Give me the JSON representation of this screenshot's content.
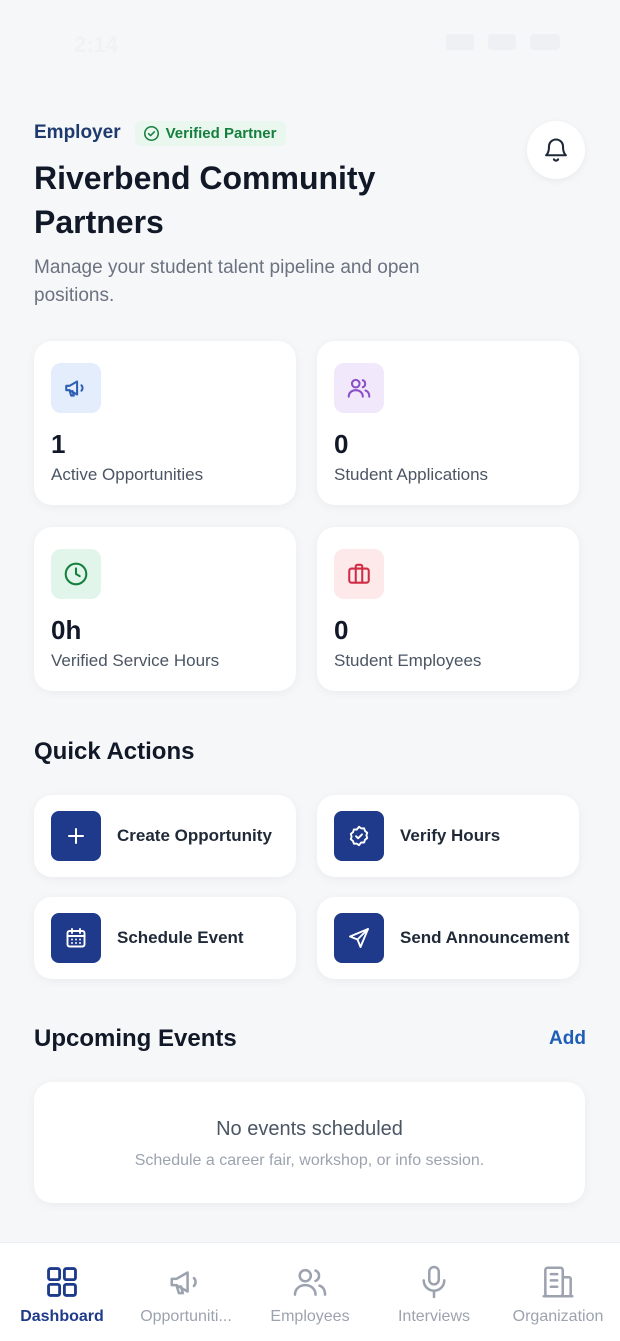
{
  "status": {
    "time": "2:14"
  },
  "header": {
    "role": "Employer",
    "badge": "Verified Partner",
    "org_name": "Riverbend Community Partners",
    "subtitle": "Manage your student talent pipeline and open positions."
  },
  "stats": [
    {
      "value": "1",
      "label": "Active Opportunities",
      "icon": "megaphone-icon",
      "bg": "#e3edfb",
      "fg": "#2f5fb3"
    },
    {
      "value": "0",
      "label": "Student Applications",
      "icon": "users-icon",
      "bg": "#f1e9fb",
      "fg": "#8b4fc9"
    },
    {
      "value": "0h",
      "label": "Verified Service Hours",
      "icon": "clock-icon",
      "bg": "#e2f5ea",
      "fg": "#15803d"
    },
    {
      "value": "0",
      "label": "Student Employees",
      "icon": "briefcase-icon",
      "bg": "#fde8ea",
      "fg": "#d12c45"
    }
  ],
  "quick_actions": {
    "title": "Quick Actions",
    "items": [
      {
        "label": "Create Opportunity",
        "icon": "plus-icon"
      },
      {
        "label": "Verify Hours",
        "icon": "badge-check-icon"
      },
      {
        "label": "Schedule Event",
        "icon": "calendar-icon"
      },
      {
        "label": "Send Announcement",
        "icon": "send-icon"
      }
    ]
  },
  "events": {
    "title": "Upcoming Events",
    "add_label": "Add",
    "empty_title": "No events scheduled",
    "empty_hint": "Schedule a career fair, workshop, or info session."
  },
  "tabs": [
    {
      "label": "Dashboard",
      "icon": "grid-icon",
      "active": true
    },
    {
      "label": "Opportuniti...",
      "icon": "megaphone-icon",
      "active": false
    },
    {
      "label": "Employees",
      "icon": "users-icon",
      "active": false
    },
    {
      "label": "Interviews",
      "icon": "microphone-icon",
      "active": false
    },
    {
      "label": "Organization",
      "icon": "building-icon",
      "active": false
    }
  ],
  "colors": {
    "accent": "#1f3a8a",
    "link": "#1e5eb8",
    "verified": "#15803d"
  }
}
